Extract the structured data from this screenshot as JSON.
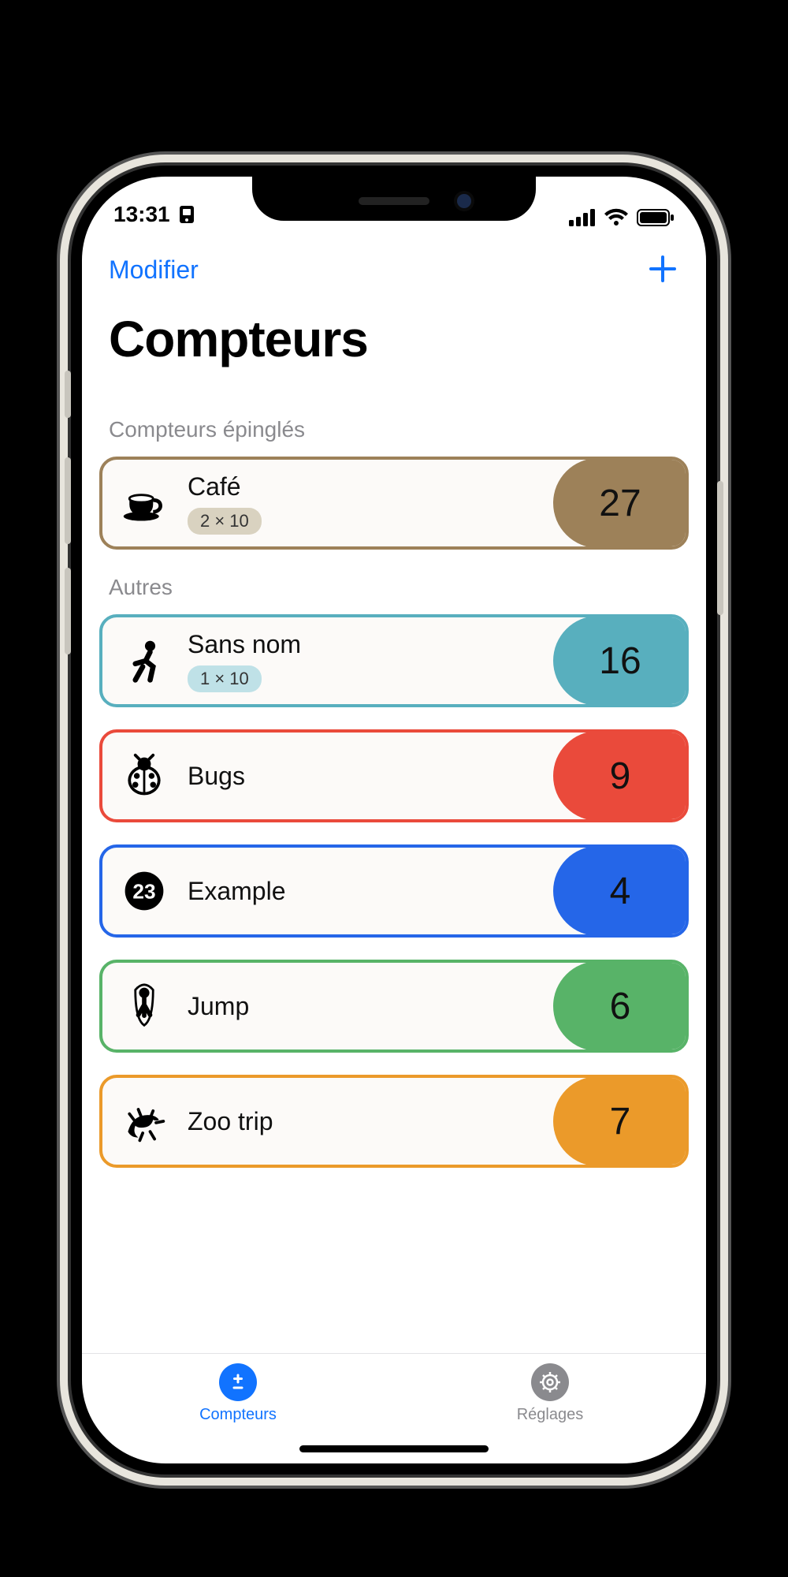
{
  "status": {
    "time": "13:31"
  },
  "nav": {
    "edit": "Modifier"
  },
  "title": "Compteurs",
  "sections": {
    "pinned": {
      "header": "Compteurs épinglés"
    },
    "others": {
      "header": "Autres"
    }
  },
  "pinned": [
    {
      "name": "Café",
      "badge": "2 × 10",
      "count": "27",
      "color": "#9d8159",
      "badgeBg": "#d9d2c0",
      "icon": "coffee"
    }
  ],
  "others": [
    {
      "name": "Sans nom",
      "badge": "1 × 10",
      "count": "16",
      "color": "#58afbe",
      "badgeBg": "#bfe1e7",
      "icon": "runner"
    },
    {
      "name": "Bugs",
      "badge": null,
      "count": "9",
      "color": "#ea4a3b",
      "badgeBg": "",
      "icon": "ladybug"
    },
    {
      "name": "Example",
      "badge": null,
      "count": "4",
      "color": "#2566e8",
      "badgeBg": "",
      "icon": "num23"
    },
    {
      "name": "Jump",
      "badge": null,
      "count": "6",
      "color": "#58b368",
      "badgeBg": "",
      "icon": "jumprope"
    },
    {
      "name": "Zoo trip",
      "badge": null,
      "count": "7",
      "color": "#eb9a2a",
      "badgeBg": "",
      "icon": "lizard"
    }
  ],
  "tabs": {
    "counters": "Compteurs",
    "settings": "Réglages"
  }
}
